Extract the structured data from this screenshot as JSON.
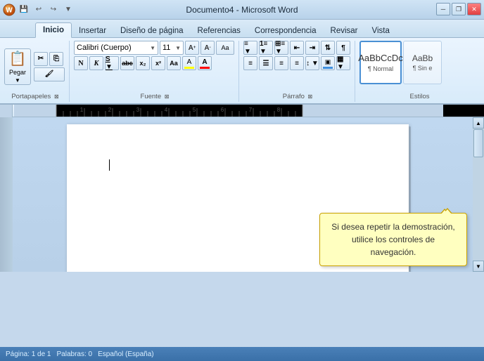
{
  "titleBar": {
    "title": "Documento4 - Microsoft Word",
    "quickAccess": [
      "💾",
      "↩",
      "↪",
      "▼"
    ]
  },
  "tabs": [
    {
      "id": "inicio",
      "label": "Inicio",
      "active": true
    },
    {
      "id": "insertar",
      "label": "Insertar",
      "active": false
    },
    {
      "id": "diseno",
      "label": "Diseño de página",
      "active": false
    },
    {
      "id": "referencias",
      "label": "Referencias",
      "active": false
    },
    {
      "id": "correspondencia",
      "label": "Correspondencia",
      "active": false
    },
    {
      "id": "revisar",
      "label": "Revisar",
      "active": false
    },
    {
      "id": "vista",
      "label": "Vista",
      "active": false
    }
  ],
  "ribbon": {
    "groups": {
      "clipboard": {
        "label": "Portapapeles",
        "paste": "Pegar",
        "cut": "✂",
        "copy": "⎘",
        "format_painter": "🖌"
      },
      "font": {
        "label": "Fuente",
        "fontName": "Calibri (Cuerpo)",
        "fontSize": "11",
        "bold": "N",
        "italic": "K",
        "underline": "S",
        "strikethrough": "abc",
        "subscript": "x₂",
        "superscript": "x²",
        "change_case": "Aa",
        "highlight": "A",
        "font_color": "A"
      },
      "paragraph": {
        "label": "Párrafo",
        "bullets": "☰",
        "numbering": "☰",
        "multilevel": "☰",
        "decrease_indent": "←",
        "increase_indent": "→",
        "sort": "↕",
        "show_marks": "¶",
        "align_left": "≡",
        "align_center": "≡",
        "align_right": "≡",
        "justify": "≡",
        "line_spacing": "↕",
        "shading": "▣",
        "borders": "▦"
      },
      "styles": {
        "label": "Estilos",
        "normal_label": "¶ Normal",
        "style2_label": "¶ Sin e"
      }
    }
  },
  "document": {
    "page": 1,
    "totalPages": 1,
    "words": 0,
    "language": "Español (España)"
  },
  "tooltip": {
    "text": "Si desea repetir la demostración, utilice los controles de navegación."
  },
  "windowControls": {
    "minimize": "─",
    "restore": "❐",
    "close": "✕"
  }
}
